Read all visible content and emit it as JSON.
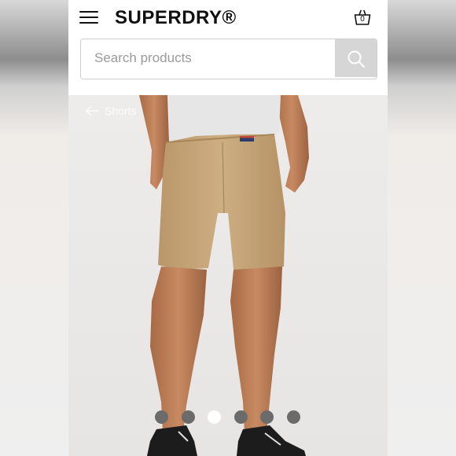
{
  "header": {
    "logo": "SUPERDRY®",
    "basket_count": "0"
  },
  "search": {
    "placeholder": "Search products"
  },
  "breadcrumb": {
    "back_label": "Shorts"
  },
  "gallery": {
    "image_count": 6,
    "active_index": 2
  },
  "icons": {
    "menu": "hamburger-menu-icon",
    "basket": "basket-icon",
    "search": "search-icon",
    "back": "arrow-left-icon"
  },
  "colors": {
    "shorts": "#c9a97c",
    "dot_inactive": "#6b6b6b",
    "dot_active": "#ffffff",
    "search_button": "#d6d6d6"
  }
}
